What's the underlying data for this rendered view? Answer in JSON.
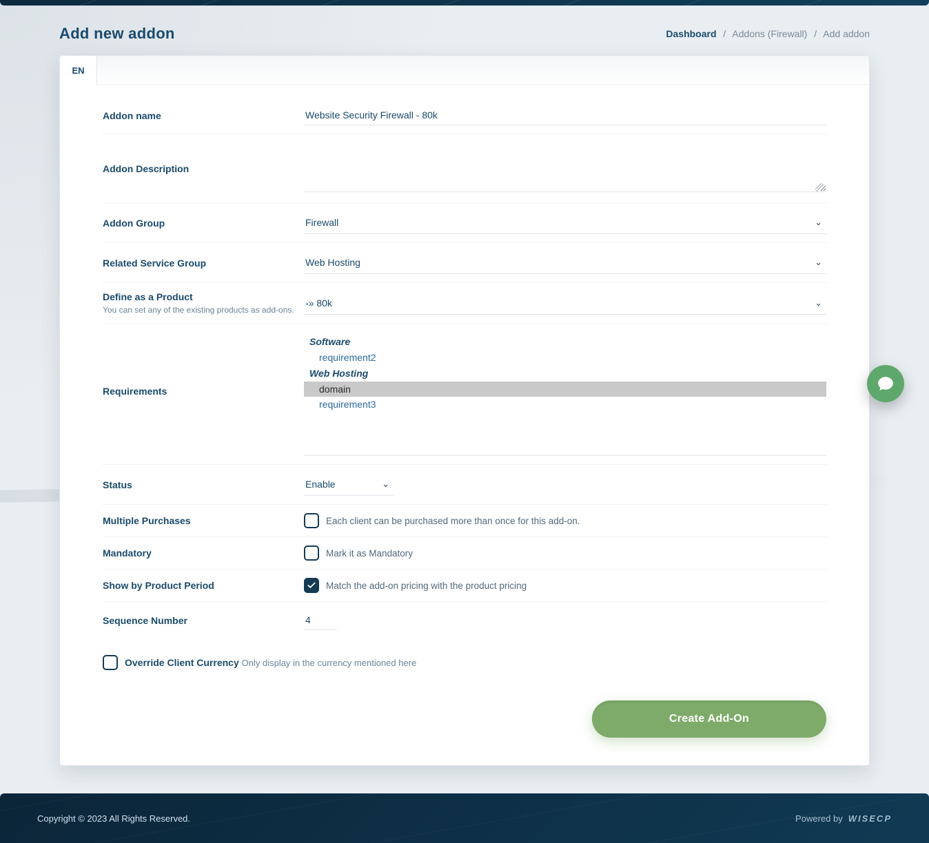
{
  "page_title": "Add new addon",
  "breadcrumb": {
    "dashboard": "Dashboard",
    "addons": "Addons (Firewall)",
    "current": "Add addon"
  },
  "lang_tab": "EN",
  "form": {
    "addon_name": {
      "label": "Addon name",
      "value": "Website Security Firewall - 80k"
    },
    "addon_description": {
      "label": "Addon Description",
      "value": ""
    },
    "addon_group": {
      "label": "Addon Group",
      "value": "Firewall"
    },
    "related_service_group": {
      "label": "Related Service Group",
      "value": "Web Hosting"
    },
    "define_as_product": {
      "label": "Define as a Product",
      "sub": "You can set any of the existing products as add-ons.",
      "value": "-» 80k"
    },
    "requirements": {
      "label": "Requirements",
      "groups": [
        {
          "name": "Software",
          "items": [
            "requirement2"
          ]
        },
        {
          "name": "Web Hosting",
          "items": [
            "domain",
            "requirement3"
          ]
        }
      ],
      "selected": "domain"
    },
    "status": {
      "label": "Status",
      "value": "Enable"
    },
    "multiple_purchases": {
      "label": "Multiple Purchases",
      "desc": "Each client can be purchased more than once for this add-on.",
      "checked": false
    },
    "mandatory": {
      "label": "Mandatory",
      "desc": "Mark it as Mandatory",
      "checked": false
    },
    "show_by_period": {
      "label": "Show by Product Period",
      "desc": "Match the add-on pricing with the product pricing",
      "checked": true
    },
    "sequence": {
      "label": "Sequence Number",
      "value": "4"
    },
    "override_currency": {
      "checked": false,
      "primary": "Override Client Currency",
      "secondary": "Only display in the currency mentioned here"
    },
    "submit_label": "Create Add-On"
  },
  "footer": {
    "copyright": "Copyright © 2023 All Rights Reserved.",
    "powered_by": "Powered by",
    "brand": "WISECP"
  }
}
